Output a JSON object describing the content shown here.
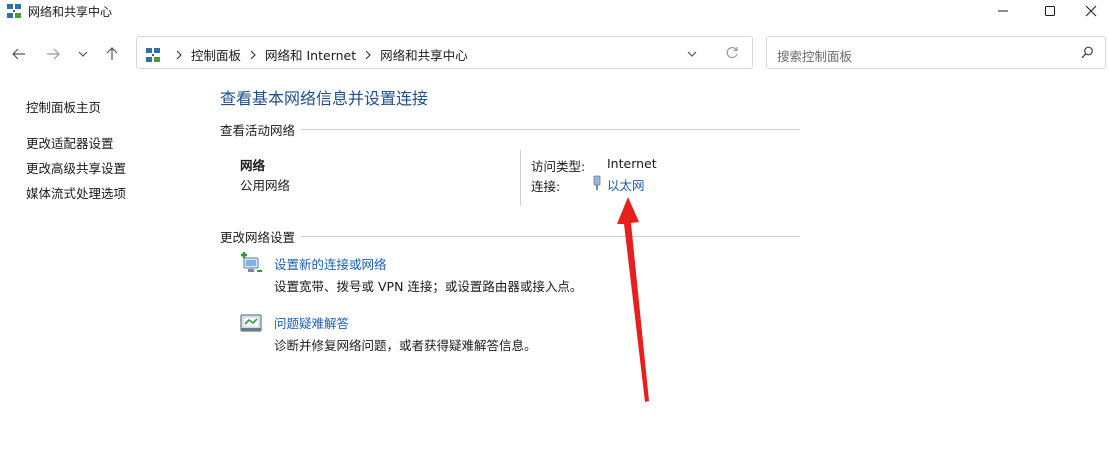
{
  "window": {
    "title": "网络和共享中心",
    "icon": "network-center-icon"
  },
  "navigation": {
    "breadcrumbs": [
      "控制面板",
      "网络和 Internet",
      "网络和共享中心"
    ],
    "search_placeholder": "搜索控制面板"
  },
  "sidebar": {
    "items": [
      {
        "label": "控制面板主页"
      },
      {
        "label": "更改适配器设置"
      },
      {
        "label": "更改高级共享设置"
      },
      {
        "label": "媒体流式处理选项"
      }
    ]
  },
  "main": {
    "title": "查看基本网络信息并设置连接",
    "active_networks_header": "查看活动网络",
    "network": {
      "name": "网络",
      "category": "公用网络",
      "access_type_label": "访问类型:",
      "access_type_value": "Internet",
      "connections_label": "连接:",
      "connection_name": "以太网"
    },
    "change_settings_header": "更改网络设置",
    "tasks": [
      {
        "link": "设置新的连接或网络",
        "desc": "设置宽带、拨号或 VPN 连接；或设置路由器或接入点。",
        "icon": "new-connection-icon"
      },
      {
        "link": "问题疑难解答",
        "desc": "诊断并修复网络问题，或者获得疑难解答信息。",
        "icon": "troubleshoot-icon"
      }
    ]
  },
  "colors": {
    "title_blue": "#1e4e8c",
    "link_blue": "#1a5fb4",
    "annotation_red": "#e8201d"
  }
}
